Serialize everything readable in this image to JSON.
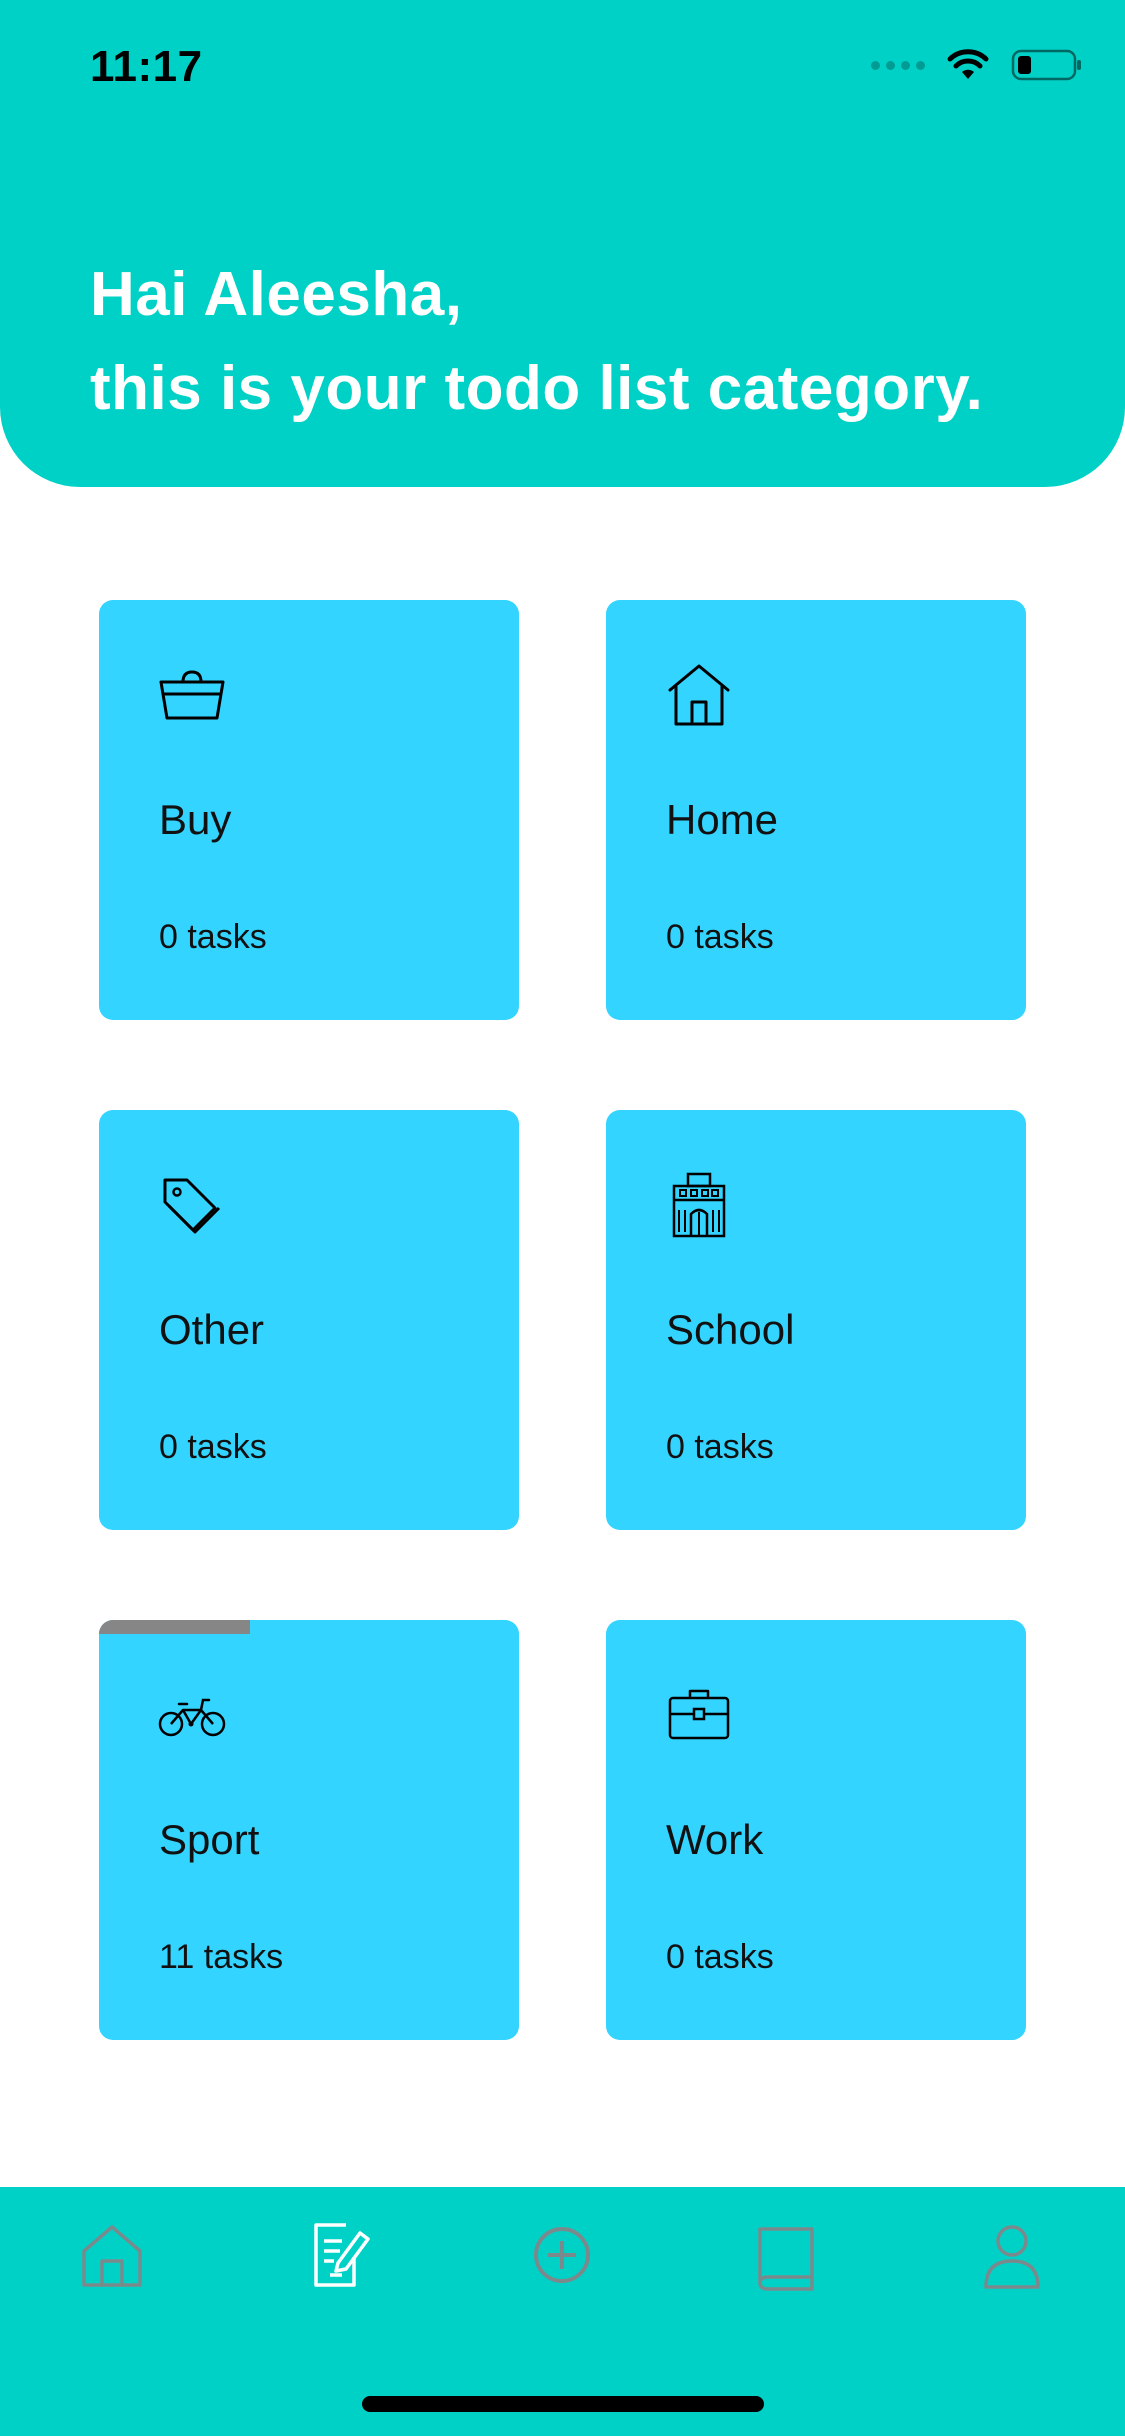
{
  "status_bar": {
    "time": "11:17",
    "icons": [
      "signal-icon",
      "wifi-icon",
      "battery-icon"
    ]
  },
  "header": {
    "greeting_line1": "Hai Aleesha,",
    "greeting_line2": "this is your todo list category."
  },
  "categories": [
    {
      "name": "Buy",
      "count": "0 tasks",
      "icon": "basket-icon",
      "progress": 0
    },
    {
      "name": "Home",
      "count": "0 tasks",
      "icon": "house-icon",
      "progress": 0
    },
    {
      "name": "Other",
      "count": "0 tasks",
      "icon": "tag-icon",
      "progress": 0
    },
    {
      "name": "School",
      "count": "0 tasks",
      "icon": "school-icon",
      "progress": 0
    },
    {
      "name": "Sport",
      "count": "11 tasks",
      "icon": "bicycle-icon",
      "progress": 0.36
    },
    {
      "name": "Work",
      "count": "0 tasks",
      "icon": "briefcase-icon",
      "progress": 0
    }
  ],
  "tabbar": {
    "tabs": [
      {
        "id": "home",
        "icon": "home-icon",
        "active": false
      },
      {
        "id": "tasks",
        "icon": "edit-note-icon",
        "active": true
      },
      {
        "id": "add",
        "icon": "add-circle-icon",
        "active": false
      },
      {
        "id": "book",
        "icon": "book-icon",
        "active": false
      },
      {
        "id": "profile",
        "icon": "user-icon",
        "active": false
      }
    ]
  },
  "colors": {
    "accent": "#00D1C6",
    "card": "#33D4FF",
    "progress": "#868686",
    "tab_inactive": "#7A8A8C",
    "tab_active": "#FFFFFF"
  }
}
